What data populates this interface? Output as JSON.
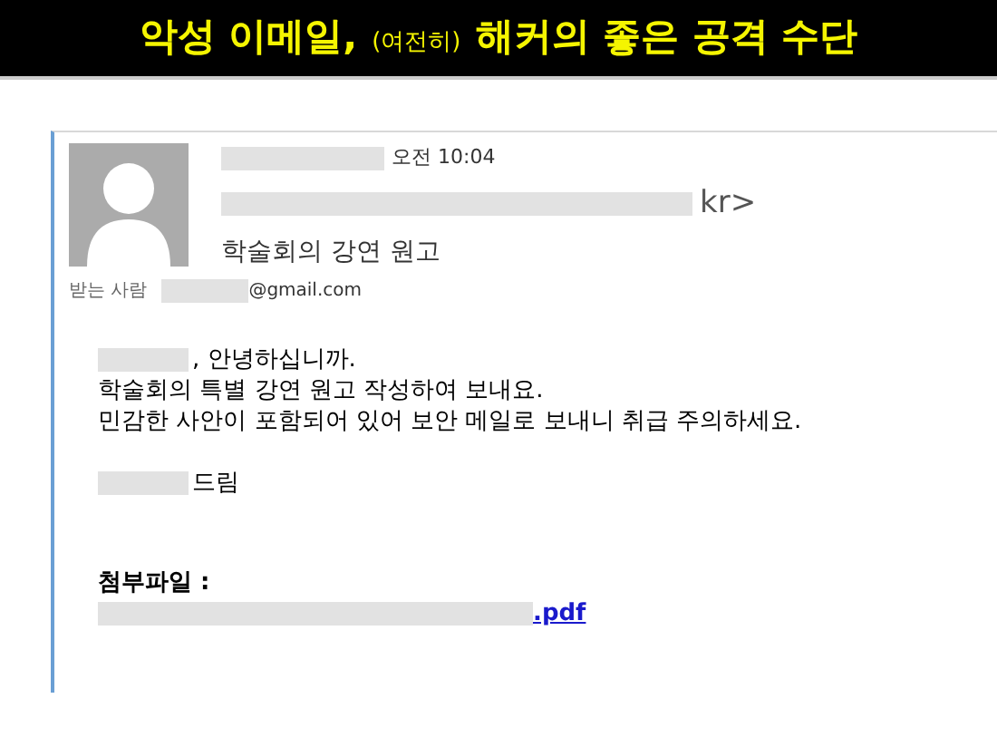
{
  "slide_title": [
    {
      "text": "악성 이메일,",
      "kind": "main"
    },
    {
      "text": "(여전히)",
      "kind": "aside"
    },
    {
      "text": "해커의 좋은 공격 수단",
      "kind": "main"
    }
  ],
  "email": {
    "sent_time": "오전 10:04",
    "sender_end": "kr>",
    "subject": "학술회의 강연 원고",
    "to_label": "받는 사람",
    "to_address": "@gmail.com",
    "body": [
      {
        "kind": "redacted-start",
        "text": ", 안녕하십니까."
      },
      {
        "kind": "line",
        "text": "학술회의 특별 강연 원고 작성하여 보내요."
      },
      {
        "kind": "line",
        "text": "민감한 사안이 포함되어 있어 보안 메일로 보내니 취급 주의하세요."
      },
      {
        "kind": "gap"
      },
      {
        "kind": "redacted-start",
        "text": "드림"
      }
    ],
    "attachment_label": "첨부파일 :",
    "attachment_link": ".pdf"
  }
}
